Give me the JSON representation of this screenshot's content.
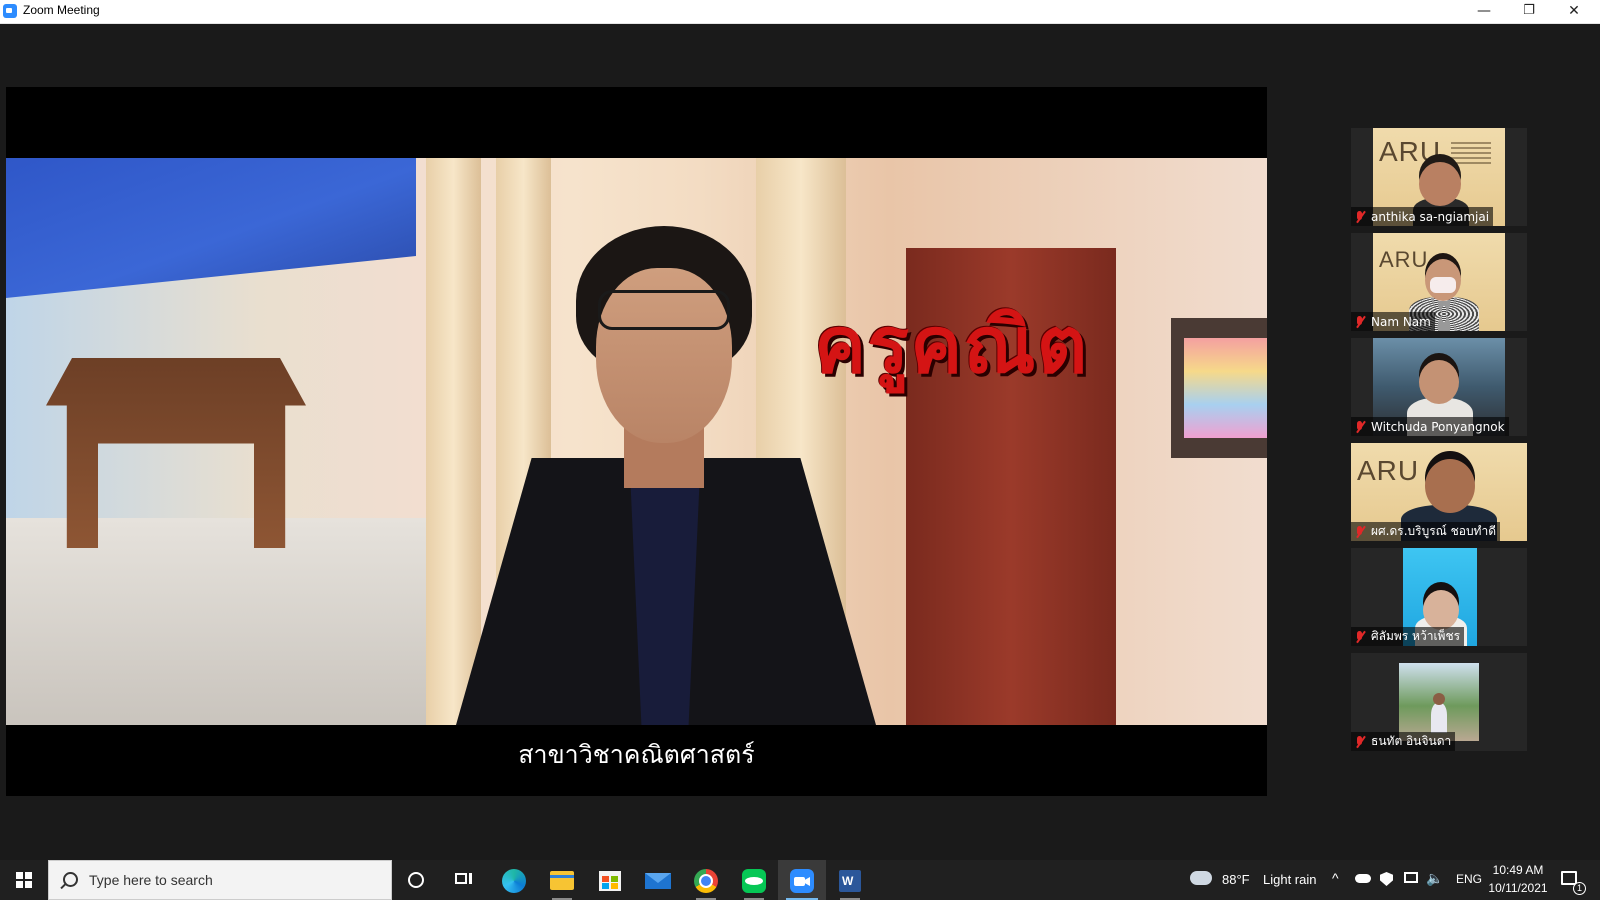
{
  "window": {
    "title": "Zoom Meeting",
    "controls": {
      "minimize": "—",
      "restore": "❐",
      "close": "✕"
    }
  },
  "stage": {
    "overlay_title": "ครูคณิต",
    "subtitle": "สาขาวิชาคณิตศาสตร์"
  },
  "participants": [
    {
      "name": "anthika sa-ngiamjai",
      "muted": true,
      "background": "ARU banner"
    },
    {
      "name": "Nam Nam",
      "muted": true,
      "background": "ARU banner"
    },
    {
      "name": "Witchuda Ponyangnok",
      "muted": true,
      "background": "room"
    },
    {
      "name": "ผศ.ดร.บริบูรณ์ ชอบทำดี",
      "muted": true,
      "background": "ARU banner"
    },
    {
      "name": "ศิลัมพร หว้าเพ็ชร",
      "muted": true,
      "background": "blue"
    },
    {
      "name": "ธนทัต อินจินดา",
      "muted": true,
      "background": "outdoor"
    }
  ],
  "banner_text": "ARU",
  "taskbar": {
    "search_placeholder": "Type here to search",
    "apps": [
      "cortana-icon",
      "task-view-icon",
      "edge-icon",
      "file-explorer-icon",
      "store-icon",
      "mail-icon",
      "chrome-icon",
      "line-icon",
      "zoom-icon",
      "word-icon"
    ],
    "weather": {
      "temp": "88°F",
      "condition": "Light rain"
    },
    "language": "ENG",
    "time": "10:49 AM",
    "date": "10/11/2021",
    "notifications": "1"
  },
  "colors": {
    "accent": "#2d8cff",
    "mute": "#e02828",
    "overlay_title": "#d41414"
  }
}
